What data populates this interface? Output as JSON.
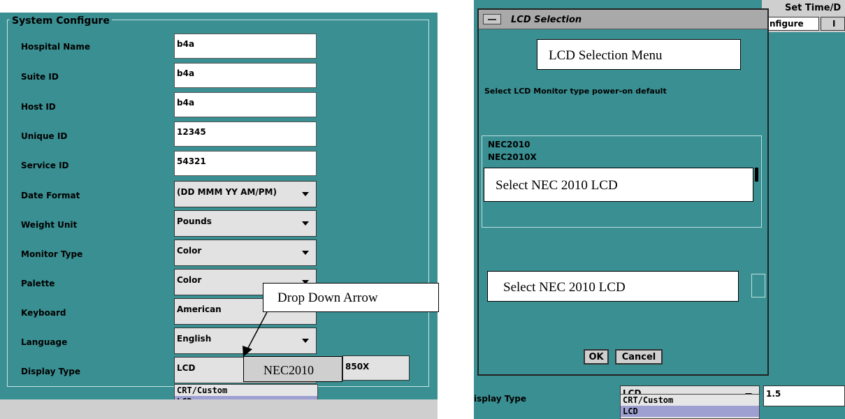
{
  "left_panel": {
    "group_title": "System Configure",
    "fields": [
      {
        "label": "Hospital Name",
        "value": "b4a"
      },
      {
        "label": "Suite ID",
        "value": "b4a"
      },
      {
        "label": "Host ID",
        "value": "b4a"
      },
      {
        "label": "Unique ID",
        "value": "12345"
      },
      {
        "label": "Service ID",
        "value": "54321"
      }
    ],
    "dropdowns": [
      {
        "label": "Date Format",
        "value": "(DD MMM YY AM/PM)"
      },
      {
        "label": "Weight Unit",
        "value": "Pounds"
      },
      {
        "label": "Monitor Type",
        "value": "Color"
      },
      {
        "label": "Palette",
        "value": "Color"
      },
      {
        "label": "Keyboard",
        "value": "American"
      },
      {
        "label": "Language",
        "value": "English"
      },
      {
        "label": "Display Type",
        "value": "LCD"
      }
    ],
    "display_extra": "850X",
    "list_options": [
      "CRT/Custom",
      "LCD"
    ],
    "callout_drop_down": "Drop Down Arrow",
    "callout_nec": "NEC2010"
  },
  "right_panel": {
    "bg_header_1": "Set Time/D",
    "bg_tab_1": "nfigure",
    "bg_tab_2": "I",
    "dialog_title": "LCD Selection",
    "callout_menu": "LCD Selection Menu",
    "instruction": "Select LCD Monitor type power-on default",
    "lcd_options": [
      "NEC2010",
      "NEC2010X"
    ],
    "callout_select_1": "Select NEC 2010 LCD",
    "callout_select_2": "Select NEC 2010 LCD",
    "ok_label": "OK",
    "cancel_label": "Cancel",
    "display_type_label": "isplay Type",
    "display_type_value": "LCD",
    "extra_value": "1.5",
    "list_options": [
      "CRT/Custom",
      "LCD"
    ]
  }
}
